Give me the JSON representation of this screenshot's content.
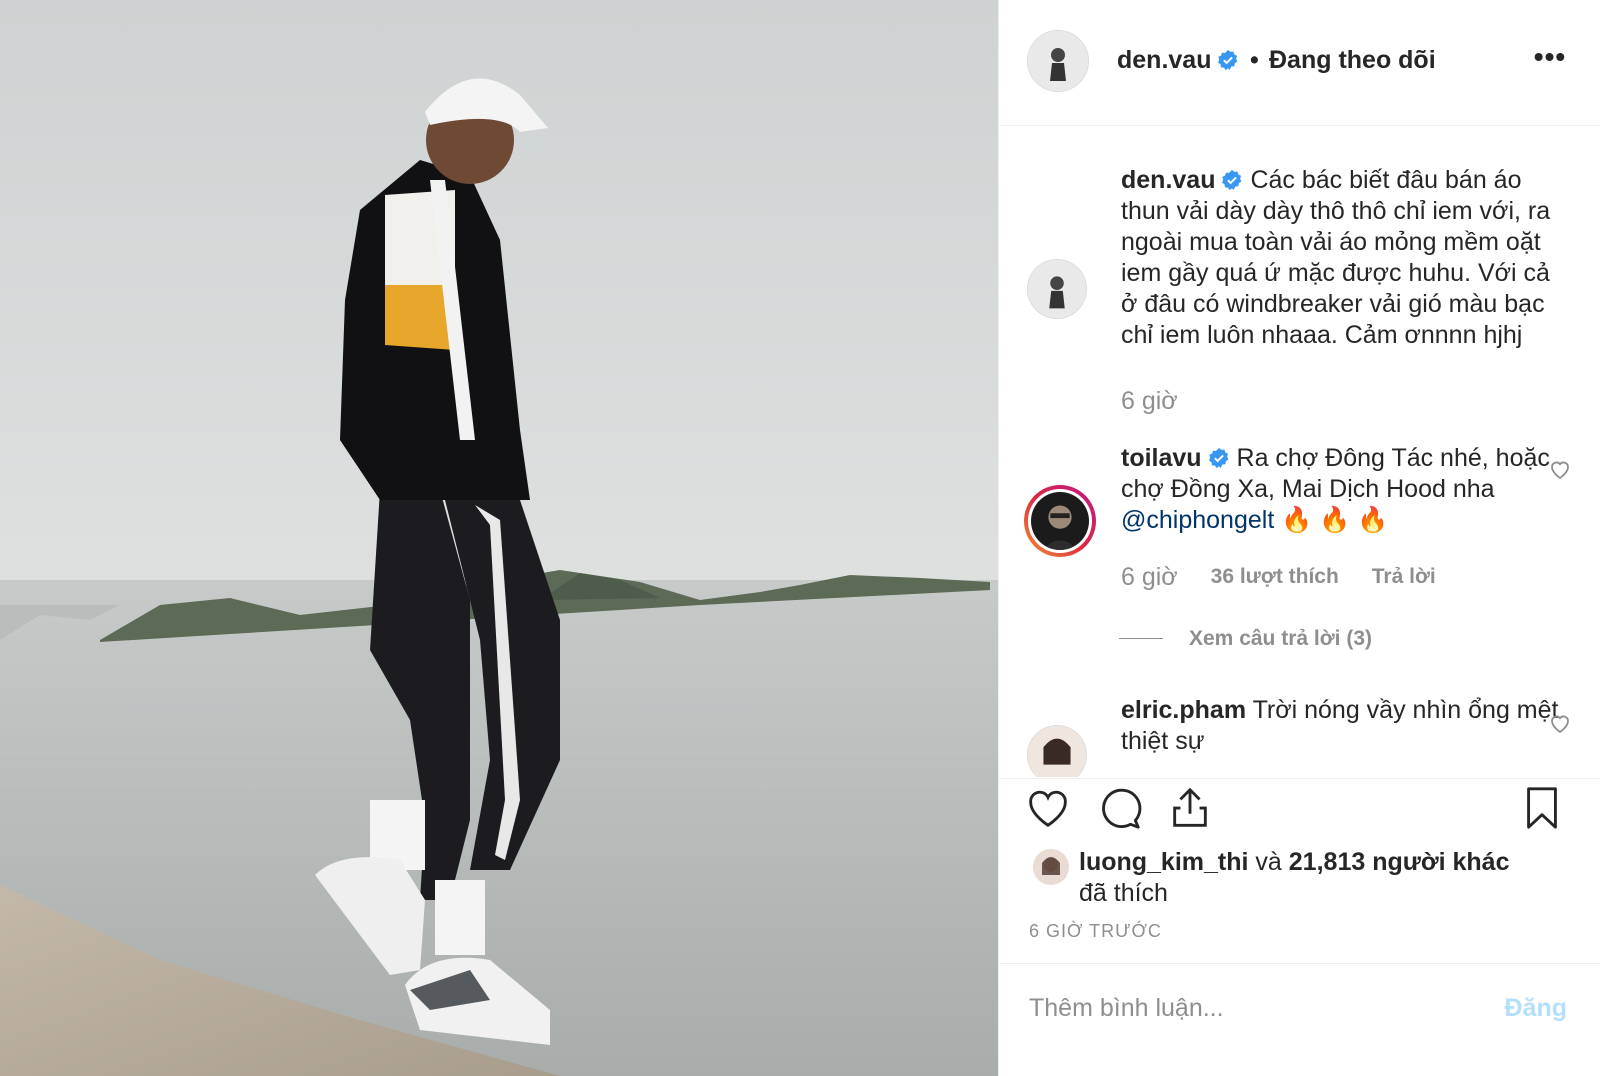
{
  "header": {
    "username": "den.vau",
    "separator": "•",
    "follow_status": "Đang theo dõi",
    "more": "•••"
  },
  "comments": [
    {
      "username": "den.vau",
      "text": "Các bác biết đâu bán áo thun vải dày dày thô thô chỉ iem với, ra ngoài mua toàn vải áo mỏng mềm oặt iem gầy quá ứ mặc được huhu. Với cả ở đâu có windbreaker vải gió màu bạc chỉ iem luôn nhaaa. Cảm ơnnnn hjhj",
      "time": "6 giờ"
    },
    {
      "username": "toilavu",
      "text": "Ra chợ Đông Tác nhé, hoặc chợ Đồng Xa, Mai Dịch Hood nha",
      "mention": "@chiphongelt",
      "emoji": "🔥 🔥 🔥",
      "time": "6 giờ",
      "likes": "36 lượt thích",
      "reply": "Trả lời"
    },
    {
      "username": "elric.pham",
      "text": "Trời nóng vầy nhìn ổng mệt thiệt sự"
    }
  ],
  "view_replies": "Xem câu trả lời (3)",
  "likes": {
    "user": "luong_kim_thi",
    "and": "và",
    "others": "21,813 người khác",
    "liked": "đã thích"
  },
  "timestamp": "6 GIỜ TRƯỚC",
  "add_comment": {
    "placeholder": "Thêm bình luận...",
    "post": "Đăng"
  },
  "icons": [
    "heart-icon",
    "comment-icon",
    "share-icon",
    "bookmark-icon",
    "verified-icon",
    "more-icon"
  ],
  "colors": {
    "verified": "#3897f0",
    "mention": "#003569",
    "muted": "#8e8e8e",
    "post_disabled": "#b2dffc"
  }
}
